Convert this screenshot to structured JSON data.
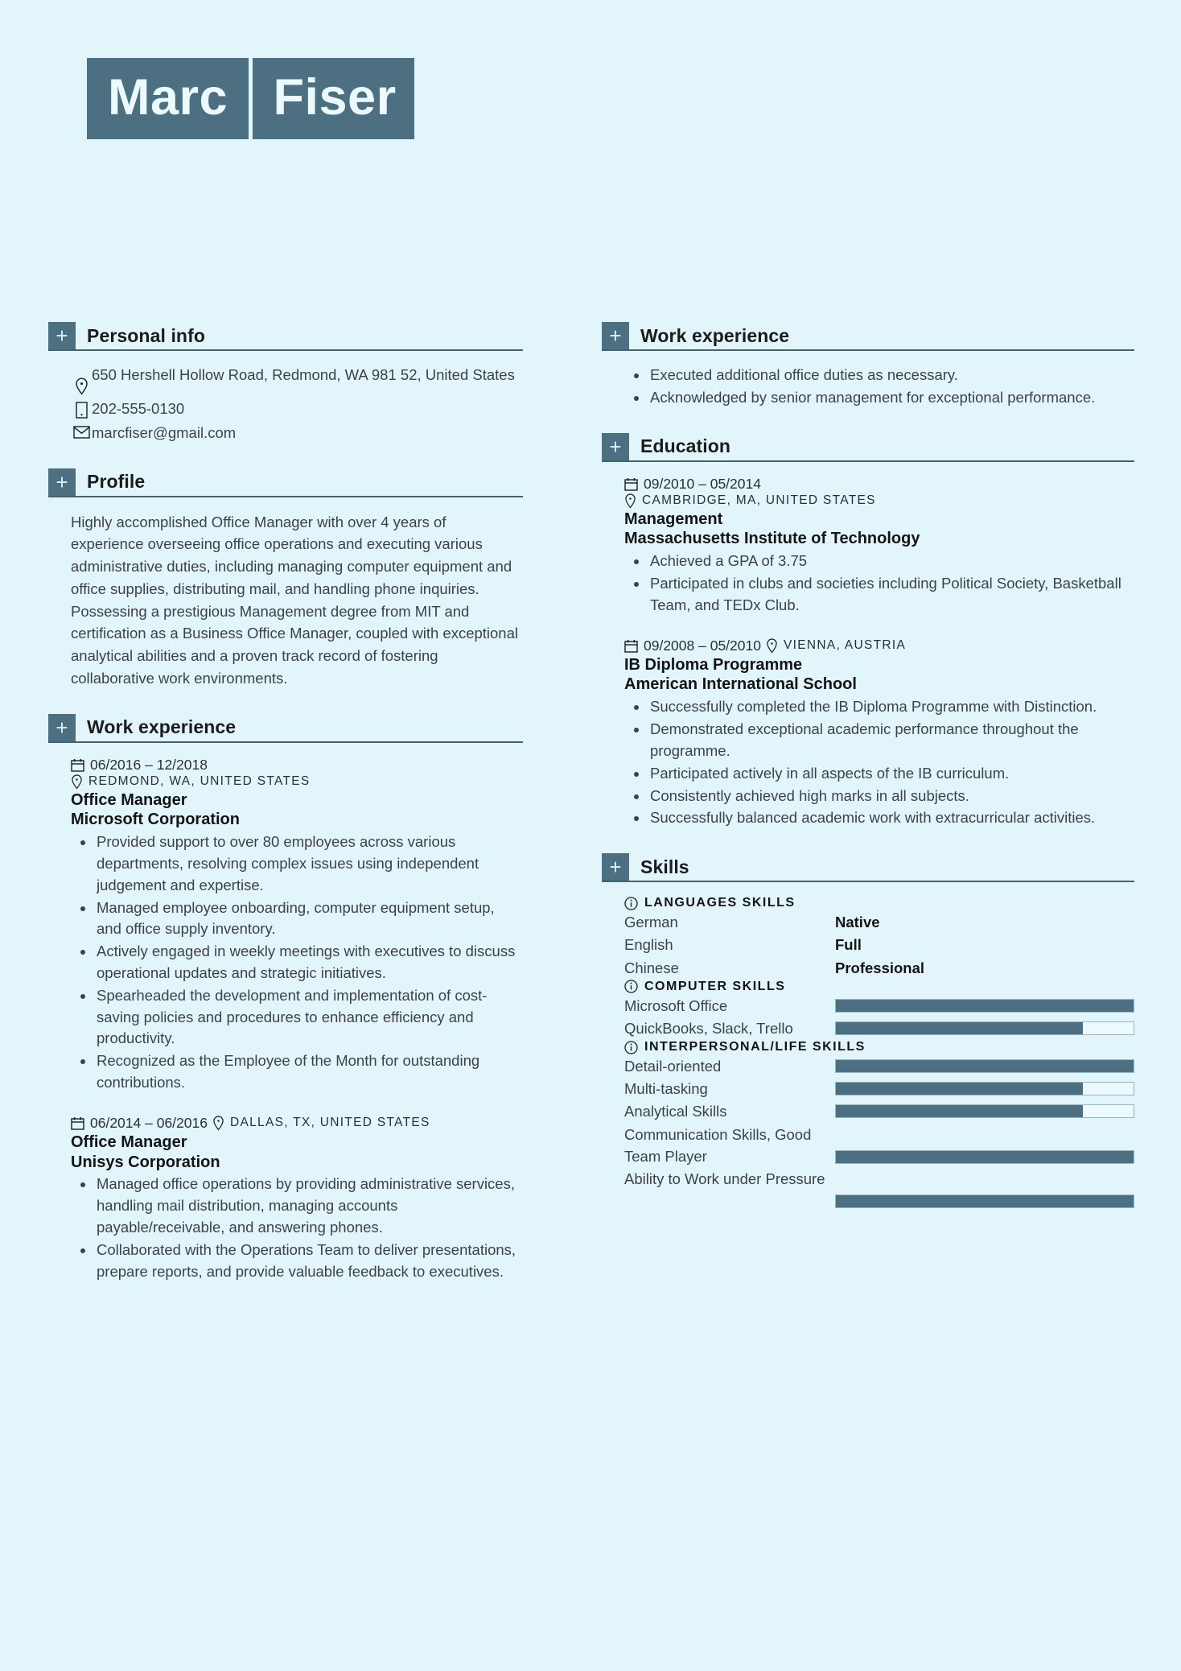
{
  "accent_color": "#4d6f82",
  "background_color": "#e2f5fa",
  "name": {
    "first": "Marc",
    "last": "Fiser"
  },
  "left_column": {
    "personal_info": {
      "heading": "Personal info",
      "plus": "+",
      "address": "650 Hershell Hollow Road, Redmond, WA 981 52, United States",
      "phone": "202-555-0130",
      "email": "marcfiser@gmail.com"
    },
    "profile": {
      "heading": "Profile",
      "plus": "+",
      "text": "Highly accomplished Office Manager with over 4 years of experience overseeing office operations and executing various administrative duties, including managing computer equipment and office supplies, distributing mail, and handling phone inquiries. Possessing a prestigious Management degree from MIT and certification as a Business Office Manager, coupled with exceptional analytical abilities and a proven track record of fostering collaborative work environments."
    },
    "work_experience": {
      "heading": "Work experience",
      "plus": "+",
      "entries": [
        {
          "dates": "06/2016 – 12/2018",
          "location": "REDMOND, WA, UNITED STATES",
          "title": "Office Manager",
          "organization": "Microsoft Corporation",
          "bullets": [
            "Provided support to over 80 employees across various departments, resolving complex issues using independent judgement and expertise.",
            "Managed employee onboarding, computer equipment setup, and office supply inventory.",
            "Actively engaged in weekly meetings with executives to discuss operational updates and strategic initiatives.",
            "Spearheaded the development and implementation of cost-saving policies and procedures to enhance efficiency and productivity.",
            "Recognized as the Employee of the Month for outstanding contributions."
          ]
        },
        {
          "dates": "06/2014 – 06/2016",
          "location": "DALLAS, TX, UNITED STATES",
          "title": "Office Manager",
          "organization": "Unisys Corporation",
          "bullets": [
            "Managed office operations by providing administrative services, handling mail distribution, managing accounts payable/receivable, and answering phones.",
            "Collaborated with the Operations Team to deliver presentations, prepare reports, and provide valuable feedback to executives."
          ]
        }
      ]
    }
  },
  "right_column": {
    "work_experience": {
      "heading": "Work experience",
      "plus": "+",
      "bullets": [
        "Executed additional office duties as necessary.",
        "Acknowledged by senior management for exceptional performance."
      ]
    },
    "education": {
      "heading": "Education",
      "plus": "+",
      "entries": [
        {
          "dates": "09/2010 – 05/2014",
          "location": "CAMBRIDGE, MA, UNITED STATES",
          "title": "Management",
          "organization": "Massachusetts Institute of Technology",
          "bullets": [
            "Achieved a GPA of 3.75",
            "Participated in clubs and societies including Political Society, Basketball Team, and TEDx Club."
          ]
        },
        {
          "dates": "09/2008 – 05/2010",
          "location": "VIENNA, AUSTRIA",
          "title": "IB Diploma Programme",
          "organization": "American International School",
          "bullets": [
            "Successfully completed the IB Diploma Programme with Distinction.",
            "Demonstrated exceptional academic performance throughout the programme.",
            "Participated actively in all aspects of the IB curriculum.",
            "Consistently achieved high marks in all subjects.",
            "Successfully balanced academic work with extracurricular activities."
          ]
        }
      ]
    },
    "skills": {
      "heading": "Skills",
      "plus": "+",
      "groups": [
        {
          "label": "LANGUAGES SKILLS",
          "type": "level",
          "items": [
            {
              "name": "German",
              "level": "Native"
            },
            {
              "name": "English",
              "level": "Full"
            },
            {
              "name": "Chinese",
              "level": "Professional"
            }
          ]
        },
        {
          "label": "COMPUTER SKILLS",
          "type": "bar",
          "items": [
            {
              "name": "Microsoft Office",
              "percent": 100
            },
            {
              "name": "QuickBooks, Slack, Trello",
              "percent": 83
            }
          ]
        },
        {
          "label": "INTERPERSONAL/LIFE SKILLS",
          "type": "bar",
          "items": [
            {
              "name": "Detail-oriented",
              "percent": 100
            },
            {
              "name": "Multi-tasking",
              "percent": 83
            },
            {
              "name": "Analytical Skills",
              "percent": 83
            },
            {
              "name": "Communication Skills, Good Team Player",
              "percent": 100
            },
            {
              "name": "Ability to Work under Pressure",
              "percent": 100
            }
          ]
        }
      ]
    }
  }
}
